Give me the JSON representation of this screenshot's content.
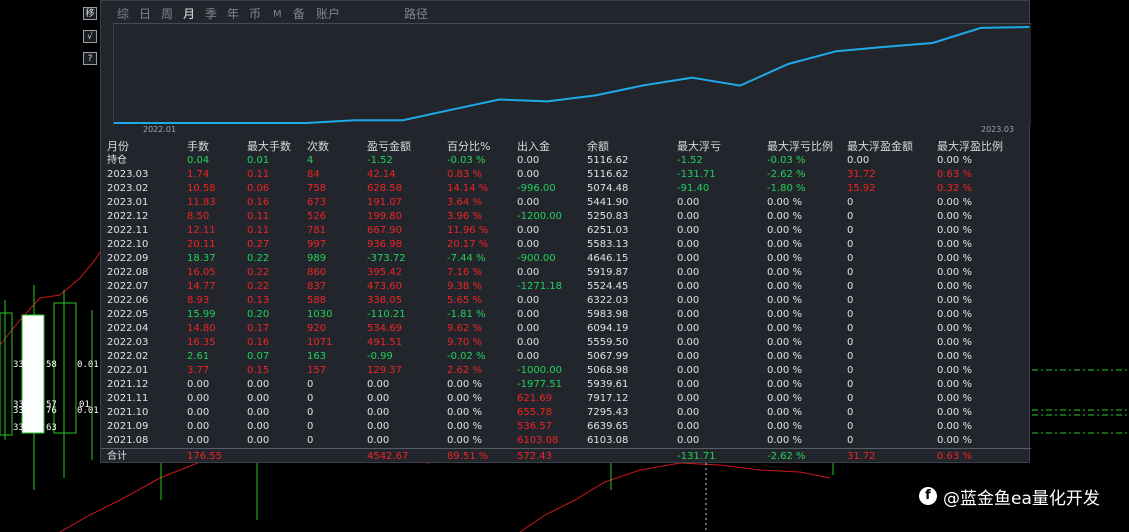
{
  "side_buttons": [
    "移",
    "√",
    "?"
  ],
  "candle_labels": [
    "33",
    "58",
    "0.01",
    "33",
    "57",
    "01",
    "33",
    "76",
    "0.01",
    "33",
    "63"
  ],
  "tabs": [
    {
      "label": "综"
    },
    {
      "label": "日"
    },
    {
      "label": "周"
    },
    {
      "label": "月",
      "active": true
    },
    {
      "label": "季"
    },
    {
      "label": "年"
    },
    {
      "label": "币"
    },
    {
      "label": "M"
    },
    {
      "label": "备"
    },
    {
      "label": "账户"
    },
    {
      "label": "路径"
    }
  ],
  "chart_data": {
    "type": "line",
    "x_start_label": "2022.01",
    "x_end_label": "2023.03",
    "line_color": "#1fa9e8",
    "x": [
      "2021.08",
      "2021.09",
      "2021.10",
      "2021.11",
      "2021.12",
      "2022.01",
      "2022.02",
      "2022.03",
      "2022.04",
      "2022.05",
      "2022.06",
      "2022.07",
      "2022.08",
      "2022.09",
      "2022.10",
      "2022.11",
      "2022.12",
      "2023.01",
      "2023.02",
      "2023.03"
    ],
    "y": [
      0.0,
      0.0,
      0.0,
      0.0,
      0.0,
      2.62,
      2.6,
      12.3,
      21.92,
      20.11,
      25.76,
      35.14,
      42.3,
      34.86,
      55.03,
      67.0,
      70.96,
      74.6,
      88.74,
      89.57
    ]
  },
  "table": {
    "headers": [
      "月份",
      "手数",
      "最大手数",
      "次数",
      "盈亏金额",
      "百分比%",
      "出入金",
      "余额",
      "最大浮亏",
      "最大浮亏比例",
      "最大浮盈金额",
      "最大浮盈比例"
    ],
    "rows": [
      {
        "cells": [
          "持仓",
          "0.04",
          "0.01",
          "4",
          "-1.52",
          "-0.03 %",
          "0.00",
          "5116.62",
          "-1.52",
          "-0.03 %",
          "0.00",
          "0.00 %"
        ],
        "colors": [
          "w",
          "g",
          "g",
          "g",
          "g",
          "g",
          "w",
          "w",
          "g",
          "g",
          "w",
          "w"
        ]
      },
      {
        "cells": [
          "2023.03",
          "1.74",
          "0.11",
          "84",
          "42.14",
          "0.83 %",
          "0.00",
          "5116.62",
          "-131.71",
          "-2.62 %",
          "31.72",
          "0.63 %"
        ],
        "colors": [
          "w",
          "r",
          "r",
          "r",
          "r",
          "r",
          "w",
          "w",
          "g",
          "g",
          "r",
          "r"
        ]
      },
      {
        "cells": [
          "2023.02",
          "10.58",
          "0.06",
          "758",
          "628.58",
          "14.14 %",
          "-996.00",
          "5074.48",
          "-91.40",
          "-1.80 %",
          "15.92",
          "0.32 %"
        ],
        "colors": [
          "w",
          "r",
          "r",
          "r",
          "r",
          "r",
          "g",
          "w",
          "g",
          "g",
          "r",
          "r"
        ]
      },
      {
        "cells": [
          "2023.01",
          "11.83",
          "0.16",
          "673",
          "191.07",
          "3.64 %",
          "0.00",
          "5441.90",
          "0.00",
          "0.00 %",
          "0",
          "0.00 %"
        ],
        "colors": [
          "w",
          "r",
          "r",
          "r",
          "r",
          "r",
          "w",
          "w",
          "w",
          "w",
          "w",
          "w"
        ]
      },
      {
        "cells": [
          "2022.12",
          "8.50",
          "0.11",
          "526",
          "199.80",
          "3.96 %",
          "-1200.00",
          "5250.83",
          "0.00",
          "0.00 %",
          "0",
          "0.00 %"
        ],
        "colors": [
          "w",
          "r",
          "r",
          "r",
          "r",
          "r",
          "g",
          "w",
          "w",
          "w",
          "w",
          "w"
        ]
      },
      {
        "cells": [
          "2022.11",
          "12.11",
          "0.11",
          "781",
          "667.90",
          "11.96 %",
          "0.00",
          "6251.03",
          "0.00",
          "0.00 %",
          "0",
          "0.00 %"
        ],
        "colors": [
          "w",
          "r",
          "r",
          "r",
          "r",
          "r",
          "w",
          "w",
          "w",
          "w",
          "w",
          "w"
        ]
      },
      {
        "cells": [
          "2022.10",
          "20.11",
          "0.27",
          "997",
          "936.98",
          "20.17 %",
          "0.00",
          "5583.13",
          "0.00",
          "0.00 %",
          "0",
          "0.00 %"
        ],
        "colors": [
          "w",
          "r",
          "r",
          "r",
          "r",
          "r",
          "w",
          "w",
          "w",
          "w",
          "w",
          "w"
        ]
      },
      {
        "cells": [
          "2022.09",
          "18.37",
          "0.22",
          "989",
          "-373.72",
          "-7.44 %",
          "-900.00",
          "4646.15",
          "0.00",
          "0.00 %",
          "0",
          "0.00 %"
        ],
        "colors": [
          "w",
          "g",
          "g",
          "g",
          "g",
          "g",
          "g",
          "w",
          "w",
          "w",
          "w",
          "w"
        ]
      },
      {
        "cells": [
          "2022.08",
          "16.05",
          "0.22",
          "860",
          "395.42",
          "7.16 %",
          "0.00",
          "5919.87",
          "0.00",
          "0.00 %",
          "0",
          "0.00 %"
        ],
        "colors": [
          "w",
          "r",
          "r",
          "r",
          "r",
          "r",
          "w",
          "w",
          "w",
          "w",
          "w",
          "w"
        ]
      },
      {
        "cells": [
          "2022.07",
          "14.77",
          "0.22",
          "837",
          "473.60",
          "9.38 %",
          "-1271.18",
          "5524.45",
          "0.00",
          "0.00 %",
          "0",
          "0.00 %"
        ],
        "colors": [
          "w",
          "r",
          "r",
          "r",
          "r",
          "r",
          "g",
          "w",
          "w",
          "w",
          "w",
          "w"
        ]
      },
      {
        "cells": [
          "2022.06",
          "8.93",
          "0.13",
          "588",
          "338.05",
          "5.65 %",
          "0.00",
          "6322.03",
          "0.00",
          "0.00 %",
          "0",
          "0.00 %"
        ],
        "colors": [
          "w",
          "r",
          "r",
          "r",
          "r",
          "r",
          "w",
          "w",
          "w",
          "w",
          "w",
          "w"
        ]
      },
      {
        "cells": [
          "2022.05",
          "15.99",
          "0.20",
          "1030",
          "-110.21",
          "-1.81 %",
          "0.00",
          "5983.98",
          "0.00",
          "0.00 %",
          "0",
          "0.00 %"
        ],
        "colors": [
          "w",
          "g",
          "g",
          "g",
          "g",
          "g",
          "w",
          "w",
          "w",
          "w",
          "w",
          "w"
        ]
      },
      {
        "cells": [
          "2022.04",
          "14.80",
          "0.17",
          "920",
          "534.69",
          "9.62 %",
          "0.00",
          "6094.19",
          "0.00",
          "0.00 %",
          "0",
          "0.00 %"
        ],
        "colors": [
          "w",
          "r",
          "r",
          "r",
          "r",
          "r",
          "w",
          "w",
          "w",
          "w",
          "w",
          "w"
        ]
      },
      {
        "cells": [
          "2022.03",
          "16.35",
          "0.16",
          "1071",
          "491.51",
          "9.70 %",
          "0.00",
          "5559.50",
          "0.00",
          "0.00 %",
          "0",
          "0.00 %"
        ],
        "colors": [
          "w",
          "r",
          "r",
          "r",
          "r",
          "r",
          "w",
          "w",
          "w",
          "w",
          "w",
          "w"
        ]
      },
      {
        "cells": [
          "2022.02",
          "2.61",
          "0.07",
          "163",
          "-0.99",
          "-0.02 %",
          "0.00",
          "5067.99",
          "0.00",
          "0.00 %",
          "0",
          "0.00 %"
        ],
        "colors": [
          "w",
          "g",
          "g",
          "g",
          "g",
          "g",
          "w",
          "w",
          "w",
          "w",
          "w",
          "w"
        ]
      },
      {
        "cells": [
          "2022.01",
          "3.77",
          "0.15",
          "157",
          "129.37",
          "2.62 %",
          "-1000.00",
          "5068.98",
          "0.00",
          "0.00 %",
          "0",
          "0.00 %"
        ],
        "colors": [
          "w",
          "r",
          "r",
          "r",
          "r",
          "r",
          "g",
          "w",
          "w",
          "w",
          "w",
          "w"
        ]
      },
      {
        "cells": [
          "2021.12",
          "0.00",
          "0.00",
          "0",
          "0.00",
          "0.00 %",
          "-1977.51",
          "5939.61",
          "0.00",
          "0.00 %",
          "0",
          "0.00 %"
        ],
        "colors": [
          "w",
          "w",
          "w",
          "w",
          "w",
          "w",
          "g",
          "w",
          "w",
          "w",
          "w",
          "w"
        ]
      },
      {
        "cells": [
          "2021.11",
          "0.00",
          "0.00",
          "0",
          "0.00",
          "0.00 %",
          "621.69",
          "7917.12",
          "0.00",
          "0.00 %",
          "0",
          "0.00 %"
        ],
        "colors": [
          "w",
          "w",
          "w",
          "w",
          "w",
          "w",
          "r",
          "w",
          "w",
          "w",
          "w",
          "w"
        ]
      },
      {
        "cells": [
          "2021.10",
          "0.00",
          "0.00",
          "0",
          "0.00",
          "0.00 %",
          "655.78",
          "7295.43",
          "0.00",
          "0.00 %",
          "0",
          "0.00 %"
        ],
        "colors": [
          "w",
          "w",
          "w",
          "w",
          "w",
          "w",
          "r",
          "w",
          "w",
          "w",
          "w",
          "w"
        ]
      },
      {
        "cells": [
          "2021.09",
          "0.00",
          "0.00",
          "0",
          "0.00",
          "0.00 %",
          "536.57",
          "6639.65",
          "0.00",
          "0.00 %",
          "0",
          "0.00 %"
        ],
        "colors": [
          "w",
          "w",
          "w",
          "w",
          "w",
          "w",
          "r",
          "w",
          "w",
          "w",
          "w",
          "w"
        ]
      },
      {
        "cells": [
          "2021.08",
          "0.00",
          "0.00",
          "0",
          "0.00",
          "0.00 %",
          "6103.08",
          "6103.08",
          "0.00",
          "0.00 %",
          "0",
          "0.00 %"
        ],
        "colors": [
          "w",
          "w",
          "w",
          "w",
          "w",
          "w",
          "r",
          "w",
          "w",
          "w",
          "w",
          "w"
        ]
      }
    ],
    "total": {
      "cells": [
        "合计",
        "176.55",
        "",
        "",
        "4542.67",
        "89.51 %",
        "572.43",
        "",
        "-131.71",
        "-2.62 %",
        "31.72",
        "0.63 %"
      ],
      "colors": [
        "w",
        "r",
        "w",
        "w",
        "r",
        "r",
        "r",
        "w",
        "g",
        "g",
        "r",
        "r"
      ]
    }
  },
  "colors": {
    "red": "#ee2424",
    "green": "#21d15a",
    "white": "#dfe3e7",
    "panel_bg": "#22262c",
    "line": "#1fa9e8"
  },
  "watermark": {
    "icon": "f",
    "text": "@蓝金鱼ea量化开发"
  }
}
